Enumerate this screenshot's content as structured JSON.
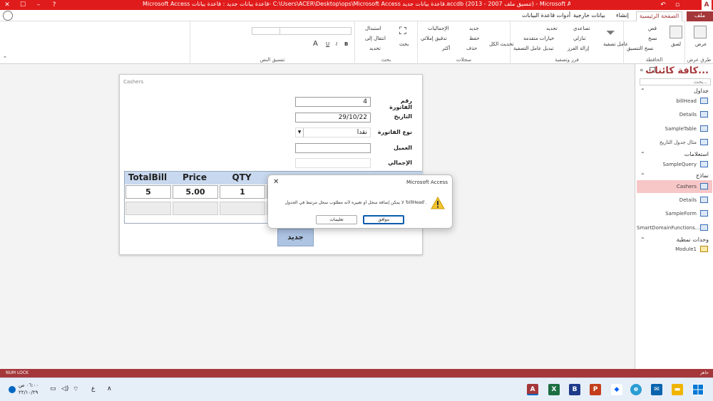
{
  "titlebar": {
    "title": "Microsoft Access قاعدة بيانات جديد : قاعدة بيانات- C:\\Users\\ACER\\Desktop\\ops\\Microsoft Access قاعدة بيانات جديد.accdb (تنسيق ملف 2007 - 2013) - Microsoft Access",
    "minimize": "–",
    "maximize": "☐",
    "close": "✕",
    "help": "?"
  },
  "tabs": {
    "file": "ملف",
    "home": "الصفحة الرئيسية",
    "create": "إنشاء",
    "external": "بيانات خارجية",
    "tools": "أدوات قاعدة البيانات"
  },
  "ribbon": {
    "views_label": "طرق عرض",
    "view_btn": "عرض",
    "clipboard_label": "الحافظة",
    "paste": "لصق",
    "cut": "قص",
    "copy": "نسخ",
    "format_painter": "نسخ التنسيق",
    "sort_label": "فرز وتصفية",
    "filter": "عامل تصفية",
    "ascending": "تصاعدي",
    "descending": "تنازلي",
    "remove_sort": "إزالة الفرز",
    "selection": "تحديد",
    "advanced": "خيارات متقدمة",
    "toggle_filter": "تبديل عامل التصفية",
    "records_label": "سجلات",
    "refresh": "تحديث الكل",
    "new": "جديد",
    "save": "حفظ",
    "delete": "حذف",
    "totals": "الإجماليات",
    "spelling": "تدقيق إملائي",
    "more": "أكثر",
    "find_label": "بحث",
    "find": "بحث",
    "replace": "استبدال",
    "goto": "انتقال إلى",
    "select": "تحديد",
    "text_label": "تنسيق النص",
    "bold": "B",
    "italic": "I",
    "underline": "U",
    "font_a": "A"
  },
  "nav": {
    "title": "كافة كائنات...",
    "search_placeholder": "بحث...",
    "groups": {
      "tables": "جداول",
      "queries": "استعلامات",
      "forms": "نماذج",
      "modules": "وحدات نمطية"
    },
    "items": {
      "billHead": "billHead",
      "details_table": "Details",
      "sampleTable": "SampleTable",
      "model_table": "مثال جدول التاريخ",
      "sampleQuery": "SampleQuery",
      "cashers": "Cashers",
      "details_form": "Details",
      "sampleForm": "SampleForm",
      "smartDomain": "SmartDomainFunctions...",
      "module1": "Module1"
    }
  },
  "form": {
    "title": "Cashers",
    "fields": {
      "invoice_no_label": "رقم الفاتورة",
      "invoice_no": "4",
      "date_label": "التاريخ",
      "date": "29/10/22",
      "type_label": "نوع الفاتورة",
      "type": "نقدا",
      "customer_label": "العميل",
      "customer": "",
      "total_label": "الإجمالي",
      "total": ""
    },
    "grid": {
      "headers": [
        "TotalBill",
        "Price",
        "QTY"
      ],
      "row": [
        "5",
        "5.00",
        "1"
      ]
    },
    "new_button": "جديد"
  },
  "dialog": {
    "title": "Microsoft Access",
    "close": "✕",
    "message": "لا يمكن إضافة سجل أو تغييره لأنه مطلوب سجل مرتبط في الجدول 'billHead'.",
    "ok": "موافق",
    "help": "تعليمات"
  },
  "statusbar": {
    "left": "NUM LOCK",
    "right": "جاهز"
  },
  "taskbar": {
    "time": "٠٦:٠٠ ص",
    "date": "٢٢/١٠/٢٩",
    "lang": "ع",
    "up_arrow": "∧"
  }
}
